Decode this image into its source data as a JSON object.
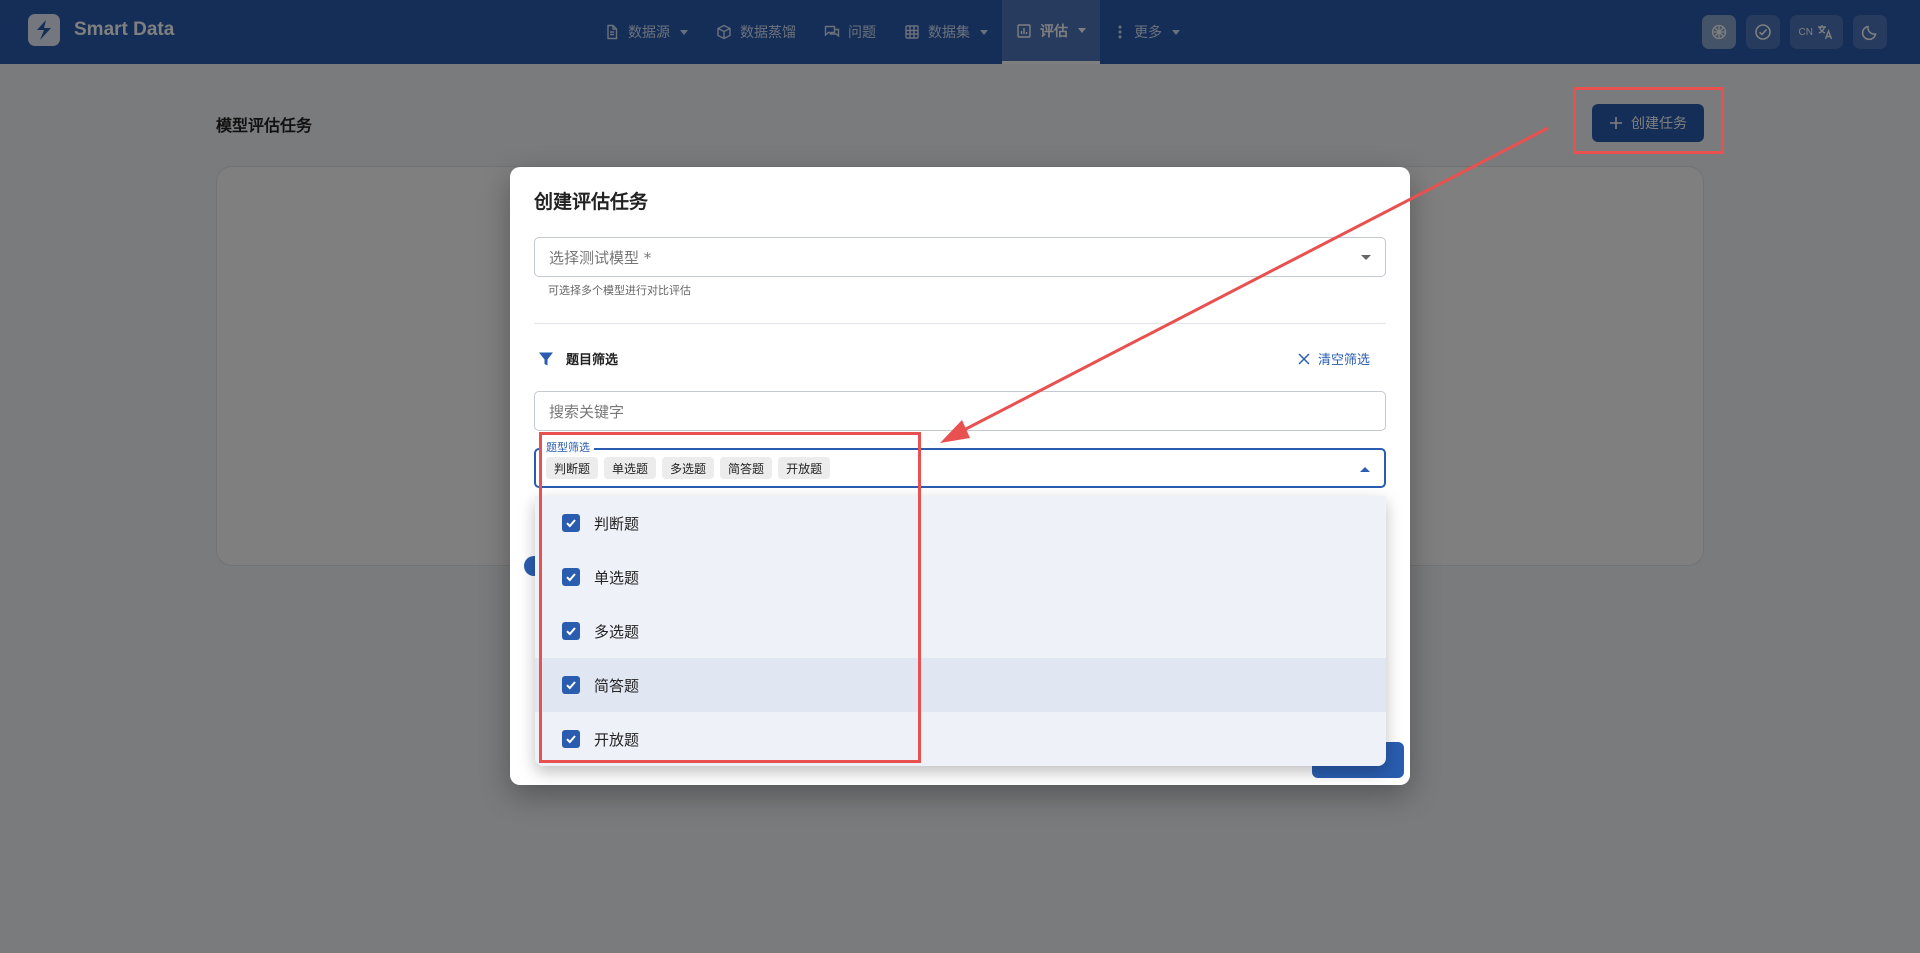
{
  "brand": {
    "name": "Smart Data"
  },
  "nav": {
    "items": [
      {
        "label": "数据源",
        "icon": "document-icon",
        "dropdown": true,
        "active": false
      },
      {
        "label": "数据蒸馏",
        "icon": "cube-icon",
        "dropdown": false,
        "active": false
      },
      {
        "label": "问题",
        "icon": "chat-icon",
        "dropdown": false,
        "active": false
      },
      {
        "label": "数据集",
        "icon": "grid-icon",
        "dropdown": true,
        "active": false
      },
      {
        "label": "评估",
        "icon": "bar-chart-icon",
        "dropdown": true,
        "active": true
      },
      {
        "label": "更多",
        "icon": "more-vert-icon",
        "dropdown": true,
        "active": false
      }
    ]
  },
  "top_actions": {
    "lang_code": "CN"
  },
  "page": {
    "title": "模型评估任务",
    "create_button": "创建任务"
  },
  "modal": {
    "title": "创建评估任务",
    "model_select": {
      "placeholder": "选择测试模型 *",
      "helper": "可选择多个模型进行对比评估"
    },
    "filter": {
      "heading": "题目筛选",
      "clear_label": "清空筛选",
      "search_placeholder": "搜索关键字",
      "type_label": "题型筛选",
      "selected_chips": [
        "判断题",
        "单选题",
        "多选题",
        "简答题",
        "开放题"
      ]
    },
    "type_options": [
      {
        "label": "判断题",
        "checked": true
      },
      {
        "label": "单选题",
        "checked": true
      },
      {
        "label": "多选题",
        "checked": true
      },
      {
        "label": "简答题",
        "checked": true
      },
      {
        "label": "开放题",
        "checked": true
      }
    ]
  },
  "colors": {
    "primary": "#2a5db0",
    "annotation": "#e8514f"
  }
}
